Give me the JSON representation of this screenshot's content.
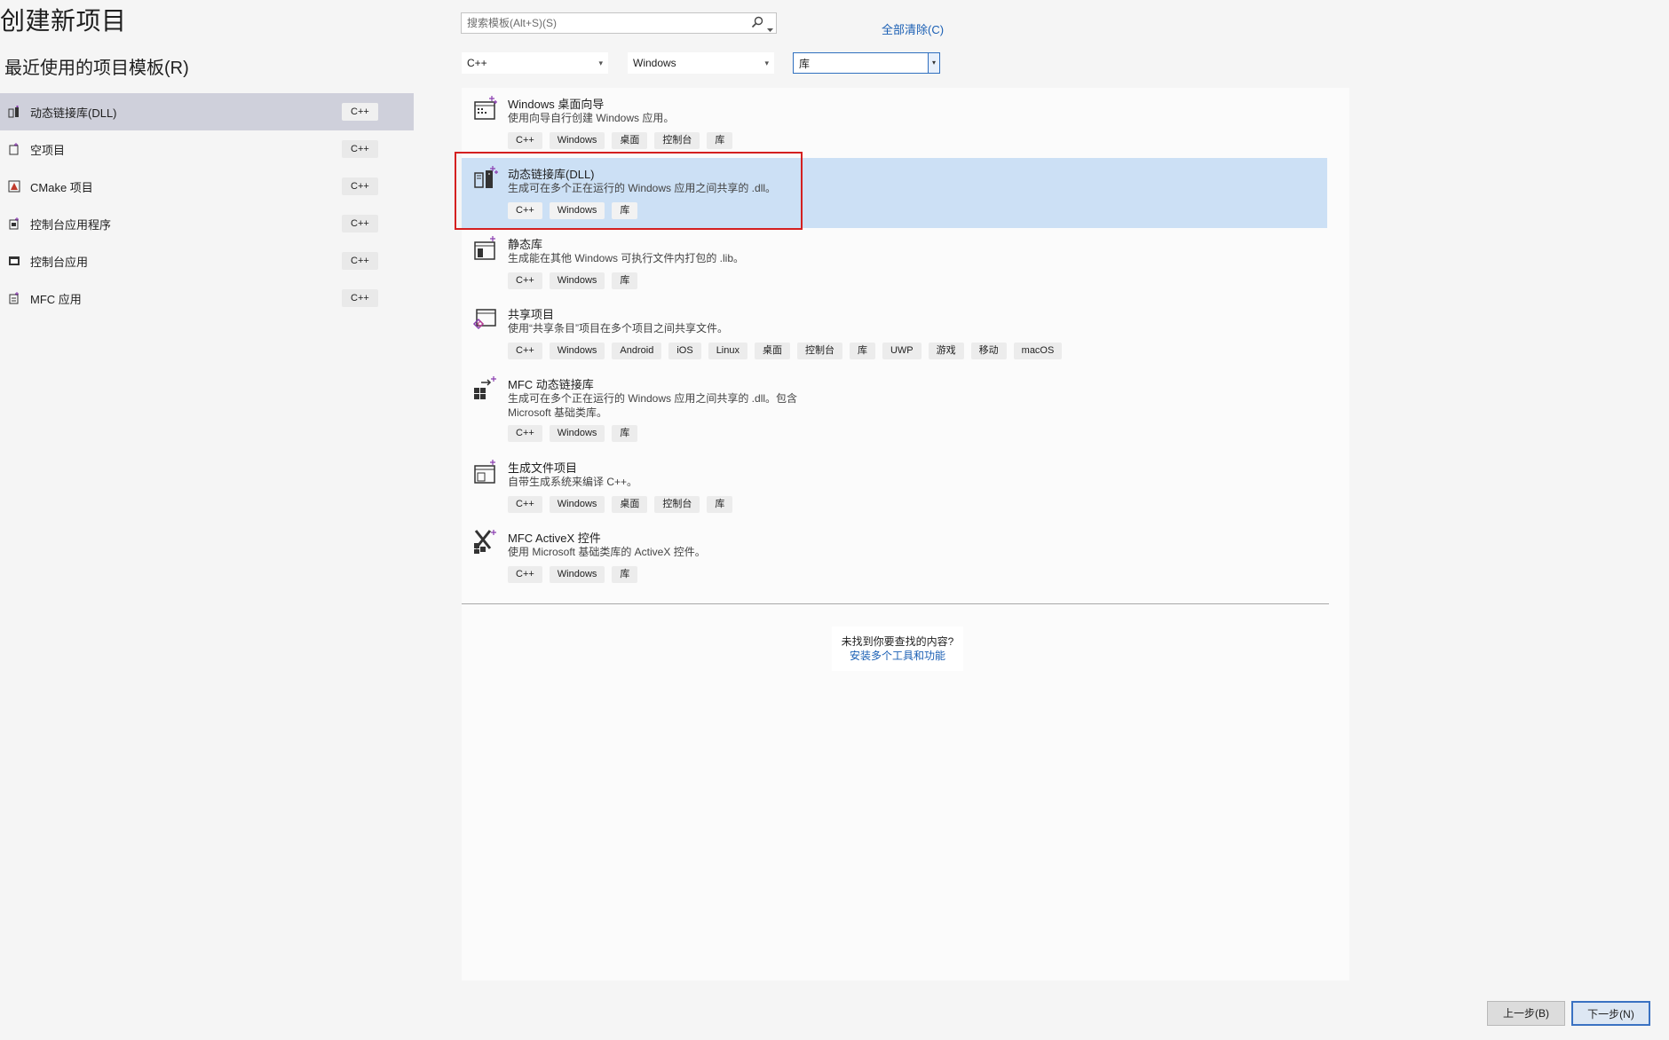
{
  "header": {
    "title": "创建新项目",
    "recent_title": "最近使用的项目模板(R)"
  },
  "recent": [
    {
      "label": "动态链接库(DLL)",
      "tag": "C++",
      "selected": true
    },
    {
      "label": "空项目",
      "tag": "C++"
    },
    {
      "label": "CMake 项目",
      "tag": "C++"
    },
    {
      "label": "控制台应用程序",
      "tag": "C++"
    },
    {
      "label": "控制台应用",
      "tag": "C++"
    },
    {
      "label": "MFC 应用",
      "tag": "C++"
    }
  ],
  "search": {
    "placeholder": "搜索模板(Alt+S)(S)",
    "value": ""
  },
  "clear_all": "全部清除(C)",
  "filters": {
    "language": "C++",
    "platform": "Windows",
    "project_type": "库"
  },
  "templates": [
    {
      "name": "Windows 桌面向导",
      "desc": "使用向导自行创建 Windows 应用。",
      "tags": [
        "C++",
        "Windows",
        "桌面",
        "控制台",
        "库"
      ]
    },
    {
      "name": "动态链接库(DLL)",
      "desc": "生成可在多个正在运行的 Windows 应用之间共享的 .dll。",
      "tags": [
        "C++",
        "Windows",
        "库"
      ],
      "selected": true
    },
    {
      "name": "静态库",
      "desc": "生成能在其他 Windows 可执行文件内打包的 .lib。",
      "tags": [
        "C++",
        "Windows",
        "库"
      ]
    },
    {
      "name": "共享项目",
      "desc": "使用“共享条目”项目在多个项目之间共享文件。",
      "tags": [
        "C++",
        "Windows",
        "Android",
        "iOS",
        "Linux",
        "桌面",
        "控制台",
        "库",
        "UWP",
        "游戏",
        "移动",
        "macOS"
      ]
    },
    {
      "name": "MFC 动态链接库",
      "desc": "生成可在多个正在运行的 Windows 应用之间共享的 .dll。包含 Microsoft 基础类库。",
      "tags": [
        "C++",
        "Windows",
        "库"
      ]
    },
    {
      "name": "生成文件项目",
      "desc": "自带生成系统来编译 C++。",
      "tags": [
        "C++",
        "Windows",
        "桌面",
        "控制台",
        "库"
      ]
    },
    {
      "name": "MFC ActiveX 控件",
      "desc": "使用 Microsoft 基础类库的 ActiveX 控件。",
      "tags": [
        "C++",
        "Windows",
        "库"
      ]
    }
  ],
  "notfound": {
    "question": "未找到你要查找的内容?",
    "link": "安装多个工具和功能"
  },
  "footer": {
    "back": "上一步(B)",
    "next": "下一步(N)"
  }
}
